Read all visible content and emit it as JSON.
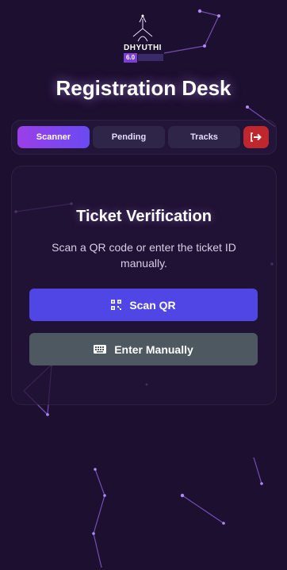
{
  "logo": {
    "name": "DHYUTHI",
    "version": "6.0"
  },
  "page_title": "Registration Desk",
  "tabs": [
    {
      "label": "Scanner",
      "active": true
    },
    {
      "label": "Pending",
      "active": false
    },
    {
      "label": "Tracks",
      "active": false
    }
  ],
  "logout": {
    "icon": "sign-out-icon",
    "color": "#c0262e"
  },
  "card": {
    "title": "Ticket Verification",
    "subtitle": "Scan a QR code or enter the ticket ID manually.",
    "scan_button": {
      "label": "Scan QR",
      "icon": "qr-code-icon"
    },
    "manual_button": {
      "label": "Enter Manually",
      "icon": "keyboard-icon"
    }
  },
  "colors": {
    "background": "#1c0f30",
    "accent": "#5046e5",
    "tab_active_start": "#9b3fe8",
    "tab_active_end": "#6a4af2",
    "secondary_button": "#4d5861",
    "danger": "#c0262e"
  }
}
